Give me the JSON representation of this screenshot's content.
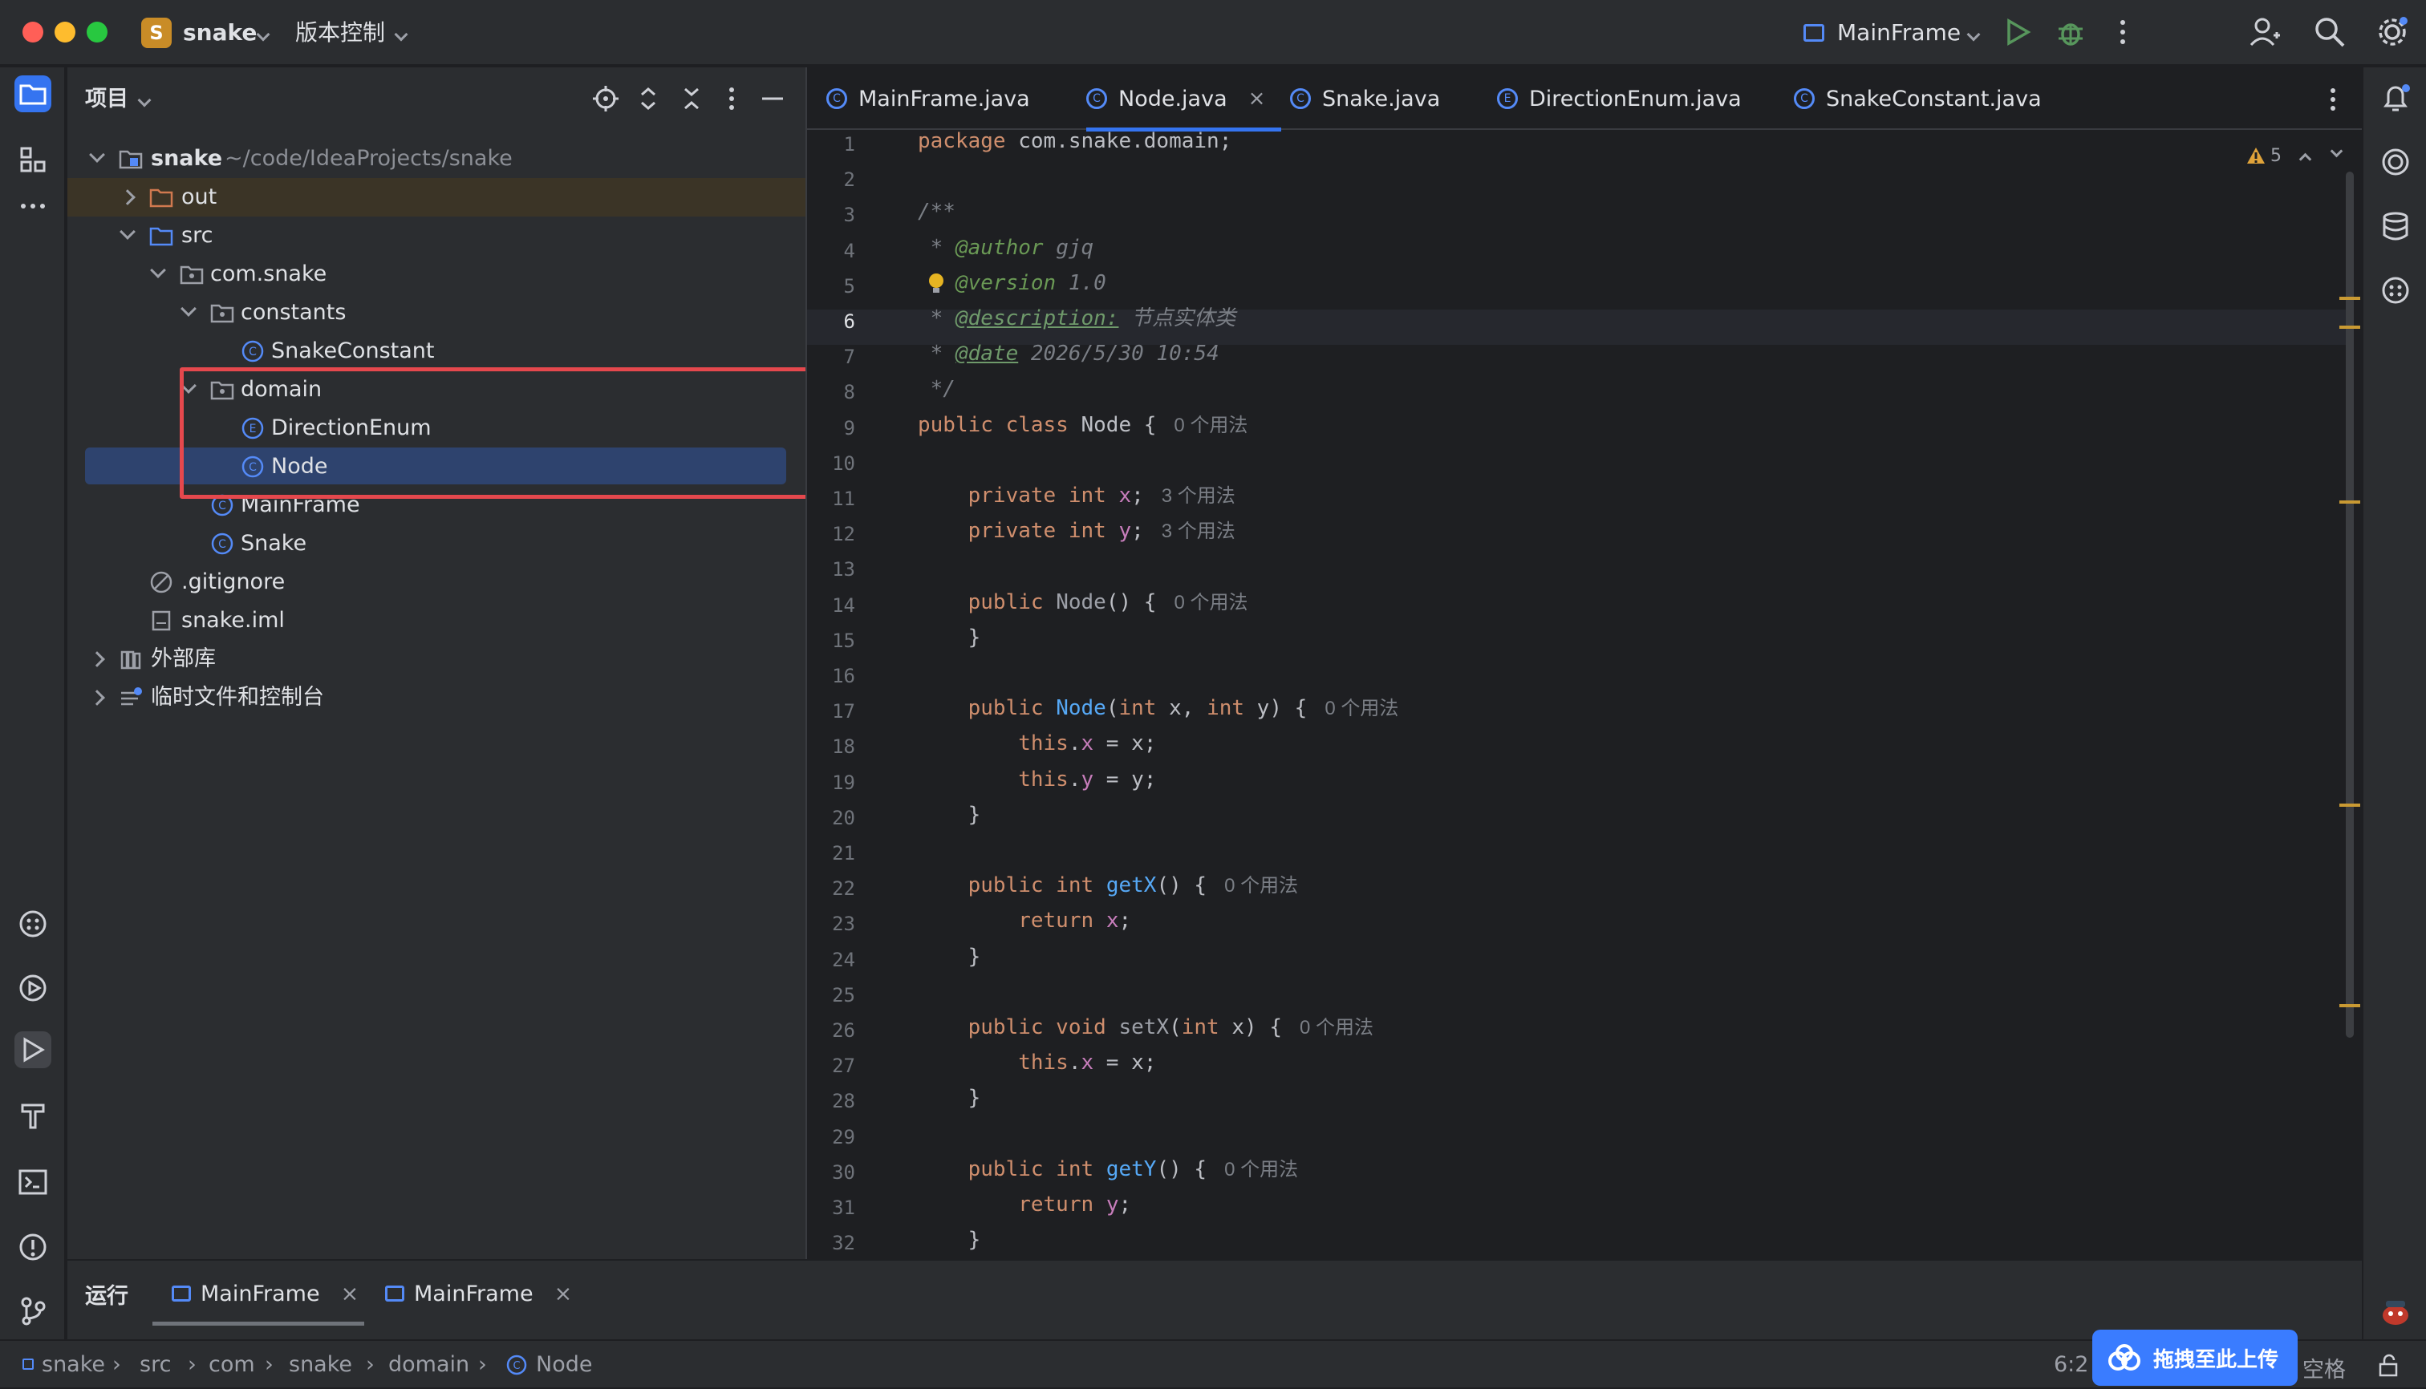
{
  "titlebar": {
    "project_badge": "S",
    "project_name": "snake",
    "vcs_menu": "版本控制",
    "run_config": "MainFrame"
  },
  "project_panel": {
    "title": "项目",
    "tree": [
      {
        "label": "snake",
        "sub": "~/code/IdeaProjects/snake"
      },
      {
        "label": "out"
      },
      {
        "label": "src"
      },
      {
        "label": "com.snake"
      },
      {
        "label": "constants"
      },
      {
        "label": "SnakeConstant"
      },
      {
        "label": "domain"
      },
      {
        "label": "DirectionEnum"
      },
      {
        "label": "Node"
      },
      {
        "label": "MainFrame"
      },
      {
        "label": "Snake"
      },
      {
        "label": ".gitignore"
      },
      {
        "label": "snake.iml"
      },
      {
        "label": "外部库"
      },
      {
        "label": "临时文件和控制台"
      }
    ]
  },
  "editor": {
    "tabs": [
      "MainFrame.java",
      "Node.java",
      "Snake.java",
      "DirectionEnum.java",
      "SnakeConstant.java"
    ],
    "active_tab": "Node.java",
    "warnings": "5",
    "line_numbers": [
      "1",
      "2",
      "3",
      "4",
      "5",
      "6",
      "7",
      "8",
      "9",
      "10",
      "11",
      "12",
      "13",
      "14",
      "15",
      "16",
      "17",
      "18",
      "19",
      "20",
      "21",
      "22",
      "23",
      "24",
      "25",
      "26",
      "27",
      "28",
      "29",
      "30",
      "31",
      "32"
    ],
    "code": {
      "l1a": "package ",
      "l1b": "com.snake.domain;",
      "l3": "/**",
      "l4a": " * ",
      "l4b": "@author",
      "l4c": " gjq",
      "l5a": " * ",
      "l5b": "@version",
      "l5c": " 1.0",
      "l6a": " * ",
      "l6b": "@description:",
      "l6c": " 节点实体类",
      "l7a": " * ",
      "l7b": "@date",
      "l7c": " 2026/5/30 10:54",
      "l8": " */",
      "l9a": "public class ",
      "l9b": "Node {",
      "l9h": "0 个用法",
      "l11a": "    private int ",
      "l11b": "x",
      "l11c": ";",
      "l11h": "3 个用法",
      "l12a": "    private int ",
      "l12b": "y",
      "l12c": ";",
      "l12h": "3 个用法",
      "l14a": "    public ",
      "l14b": "Node",
      "l14c": "() {",
      "l14h": "0 个用法",
      "l15": "    }",
      "l17a": "    public ",
      "l17b": "Node",
      "l17c": "(",
      "l17d": "int",
      "l17e": " x, ",
      "l17f": "int",
      "l17g": " y) {",
      "l17h": "0 个用法",
      "l18a": "        this",
      "l18b": ".",
      "l18c": "x",
      "l18d": " = x;",
      "l19a": "        this",
      "l19b": ".",
      "l19c": "y",
      "l19d": " = y;",
      "l20": "    }",
      "l22a": "    public int ",
      "l22b": "getX",
      "l22c": "() {",
      "l22h": "0 个用法",
      "l23a": "        return ",
      "l23b": "x",
      "l23c": ";",
      "l24": "    }",
      "l26a": "    public void ",
      "l26b": "setX",
      "l26c": "(",
      "l26d": "int",
      "l26e": " x) {",
      "l26h": "0 个用法",
      "l27a": "        this",
      "l27b": ".",
      "l27c": "x",
      "l27d": " = x;",
      "l28": "    }",
      "l30a": "    public int ",
      "l30b": "getY",
      "l30c": "() {",
      "l30h": "0 个用法",
      "l31a": "        return ",
      "l31b": "y",
      "l31c": ";",
      "l32": "    }"
    }
  },
  "bottom": {
    "run_label": "运行",
    "tabs": [
      "MainFrame",
      "MainFrame"
    ]
  },
  "status": {
    "breadcrumb": [
      "snake",
      "src",
      "com",
      "snake",
      "domain",
      "Node"
    ],
    "position": "6:2",
    "indent": "空格",
    "upload_label": "拖拽至此上传"
  },
  "colors": {
    "accent": "#3574f0",
    "highlight_box": "#e5484d",
    "selection": "#2e436e"
  }
}
